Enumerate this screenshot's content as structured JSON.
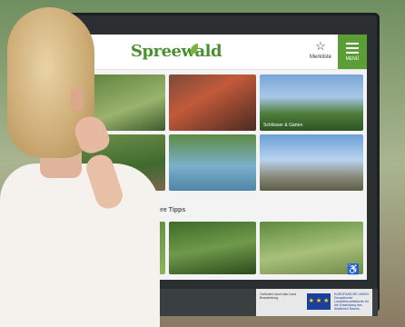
{
  "app": {
    "logo_text": "Spreewald",
    "bookmark_icon": "star-icon",
    "bookmark_label": "Merkliste",
    "menu_icon": "hamburger-menu-icon",
    "menu_label": "MENÜ"
  },
  "tiles": [
    {
      "caption": ""
    },
    {
      "caption": ""
    },
    {
      "caption": "Schlösser & Gärten"
    },
    {
      "caption": ""
    },
    {
      "caption": ""
    },
    {
      "caption": ""
    },
    {
      "caption": ""
    },
    {
      "caption": ""
    },
    {
      "caption": ""
    }
  ],
  "tips_heading": "Unsere Tipps",
  "accessibility_icon": "wheelchair-icon",
  "eu": {
    "flag_stars": "★ ★ ★",
    "text": "EUROPÄISCHE UNION Europäischer Landwirtschaftsfonds für die Entwicklung des ländlichen Raums",
    "left_text": "Gefördert durch das Land Brandenburg"
  },
  "colors": {
    "brand_green": "#5a9e35",
    "logo_green": "#4b8f33"
  }
}
